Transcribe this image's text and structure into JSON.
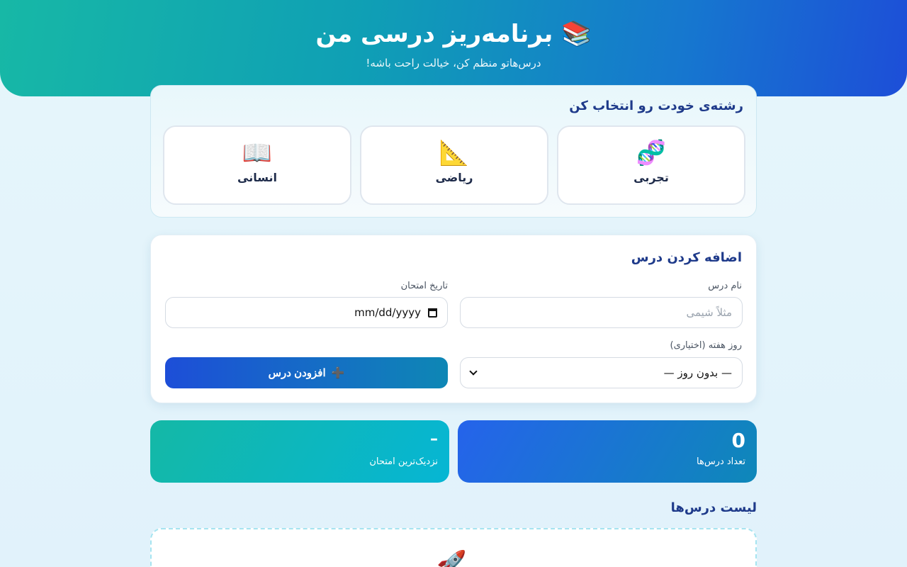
{
  "header": {
    "icon": "books-icon",
    "emoji": "📚",
    "title": "برنامه‌ریز درسی من",
    "subtitle": "درس‌هاتو منظم کن، خیالت راحت باشه!"
  },
  "field_select": {
    "title": "رشته‌ی خودت رو انتخاب کن",
    "options": [
      {
        "label": "تجربی",
        "emoji": "🧬",
        "icon": "dna-icon"
      },
      {
        "label": "ریاضی",
        "emoji": "📐",
        "icon": "triangle-ruler-icon"
      },
      {
        "label": "انسانی",
        "emoji": "📖",
        "icon": "open-book-icon"
      }
    ]
  },
  "add_course": {
    "title": "اضافه کردن درس",
    "name_label": "نام درس",
    "name_placeholder": "مثلاً شیمی",
    "date_label": "تاریخ امتحان",
    "date_value": "mm/dd/yyyy",
    "day_label": "روز هفته (اختیاری)",
    "day_value": "— بدون روز —",
    "button_emoji": "➕",
    "button_label": "افزودن درس"
  },
  "stats": {
    "count_value": "0",
    "count_label": "تعداد درس‌ها",
    "nearest_value": "–",
    "nearest_label": "نزدیک‌ترین امتحان"
  },
  "list": {
    "title": "لیست درس‌ها",
    "empty_emoji": "🚀"
  },
  "colors": {
    "accent": "#1d4ed8",
    "teal": "#14b8a6",
    "title_blue": "#1e3a8a"
  }
}
